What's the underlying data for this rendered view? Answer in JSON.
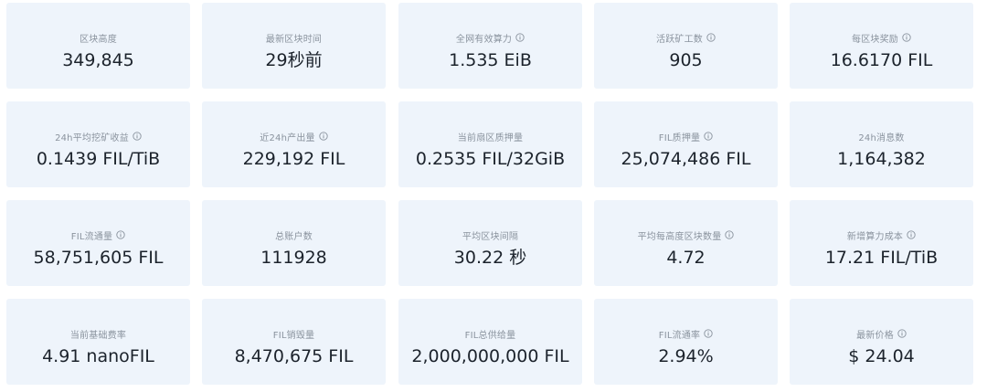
{
  "stats": [
    {
      "label": "区块高度",
      "value": "349,845",
      "info": false
    },
    {
      "label": "最新区块时间",
      "value": "29秒前",
      "info": false
    },
    {
      "label": "全网有效算力",
      "value": "1.535 EiB",
      "info": true
    },
    {
      "label": "活跃矿工数",
      "value": "905",
      "info": true
    },
    {
      "label": "每区块奖励",
      "value": "16.6170 FIL",
      "info": true
    },
    {
      "label": "24h平均挖矿收益",
      "value": "0.1439 FIL/TiB",
      "info": true
    },
    {
      "label": "近24h产出量",
      "value": "229,192 FIL",
      "info": true
    },
    {
      "label": "当前扇区质押量",
      "value": "0.2535 FIL/32GiB",
      "info": false
    },
    {
      "label": "FIL质押量",
      "value": "25,074,486 FIL",
      "info": true
    },
    {
      "label": "24h消息数",
      "value": "1,164,382",
      "info": false
    },
    {
      "label": "FIL流通量",
      "value": "58,751,605 FIL",
      "info": true
    },
    {
      "label": "总账户数",
      "value": "111928",
      "info": false
    },
    {
      "label": "平均区块间隔",
      "value": "30.22 秒",
      "info": false
    },
    {
      "label": "平均每高度区块数量",
      "value": "4.72",
      "info": true
    },
    {
      "label": "新增算力成本",
      "value": "17.21 FIL/TiB",
      "info": true
    },
    {
      "label": "当前基础费率",
      "value": "4.91 nanoFIL",
      "info": false
    },
    {
      "label": "FIL销毁量",
      "value": "8,470,675 FIL",
      "info": false
    },
    {
      "label": "FIL总供给量",
      "value": "2,000,000,000 FIL",
      "info": false
    },
    {
      "label": "FIL流通率",
      "value": "2.94%",
      "info": true
    },
    {
      "label": "最新价格",
      "value": "$ 24.04",
      "info": true
    }
  ],
  "colors": {
    "card_bg": "#eef4fb",
    "label": "#8a939e",
    "value": "#1c232c"
  },
  "icons": {
    "info": "info-circle-icon"
  }
}
